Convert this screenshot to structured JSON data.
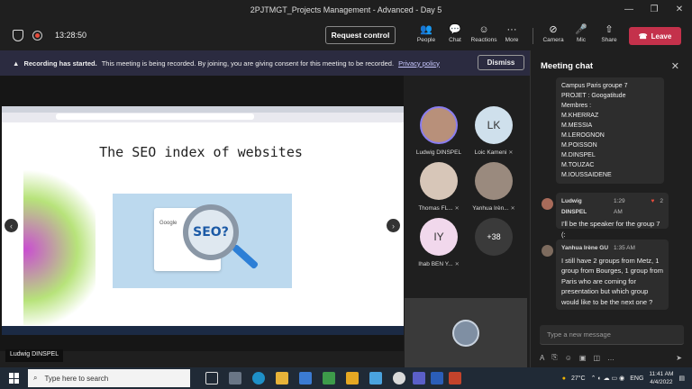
{
  "window": {
    "title": "2PJTMGT_Projects Management - Advanced - Day 5",
    "controls": [
      "—",
      "❐",
      "✕"
    ]
  },
  "toolbar": {
    "timer": "13:28:50",
    "request_control": "Request control",
    "items": [
      {
        "label": "People",
        "icon": "people-icon",
        "glyph": "👥"
      },
      {
        "label": "Chat",
        "icon": "chat-icon",
        "glyph": "💬"
      },
      {
        "label": "Reactions",
        "icon": "reactions-icon",
        "glyph": "☺"
      },
      {
        "label": "More",
        "icon": "more-icon",
        "glyph": "···"
      },
      {
        "label": "Camera",
        "icon": "camera-off-icon",
        "glyph": "⊘"
      },
      {
        "label": "Mic",
        "icon": "mic-off-icon",
        "glyph": "🎤"
      },
      {
        "label": "Share",
        "icon": "share-icon",
        "glyph": "⇧"
      }
    ],
    "leave": "Leave",
    "leave_color": "#c4314b"
  },
  "banner": {
    "bold": "Recording has started.",
    "text": "This meeting is being recorded. By joining, you are giving consent for this meeting to be recorded.",
    "link": "Privacy policy",
    "dismiss": "Dismiss"
  },
  "slide": {
    "title": "The SEO index of websites",
    "image_label": "SEO?",
    "page_label": "Google"
  },
  "presenter": "Ludwig DINSPEL",
  "participants": [
    {
      "initials": "",
      "name": "Ludwig DINSPEL",
      "muted": false,
      "color": "#b8907a",
      "photo": true
    },
    {
      "initials": "LK",
      "name": "Loic Kameni",
      "muted": true,
      "color": "#cfe0ec",
      "photo": false
    },
    {
      "initials": "",
      "name": "Thomas FL...",
      "muted": true,
      "color": "#d7c6b8",
      "photo": true
    },
    {
      "initials": "",
      "name": "Yanhua Irèn...",
      "muted": true,
      "color": "#9a8a7e",
      "photo": true
    },
    {
      "initials": "IY",
      "name": "Ihab BEN Y...",
      "muted": true,
      "color": "#f1d8ec",
      "photo": false
    },
    {
      "initials": "+38",
      "name": "",
      "muted": false,
      "color": "#3a3a3a",
      "photo": false
    }
  ],
  "chat": {
    "title": "Meeting chat",
    "first_message_lines": [
      "Campus Paris groupe 7",
      "PROJET : Googatitude",
      "Membres :",
      "M.KHERRAZ",
      "M.MESSIA",
      "M.LEROGNON",
      "M.POISSON",
      "M.DINSPEL",
      "M.TOUZAC",
      "M.IOUSSAIDENE"
    ],
    "messages": [
      {
        "author": "Ludwig DINSPEL",
        "time": "1:29 AM",
        "reactions": "2",
        "text": "I'll be the speaker for the group 7 (:"
      },
      {
        "author": "Yanhua Irène GU",
        "time": "1:35 AM",
        "reactions": "",
        "text": "I still have 2 groups from Metz, 1 group from Bourges, 1 group from Paris who are coming for presentation but which group would like to be the next one ?"
      }
    ],
    "compose_placeholder": "Type a new message"
  },
  "taskbar": {
    "search_placeholder": "Type here to search",
    "weather": "27°C",
    "lang": "ENG",
    "time": "11:41 AM",
    "date": "4/4/2022"
  }
}
